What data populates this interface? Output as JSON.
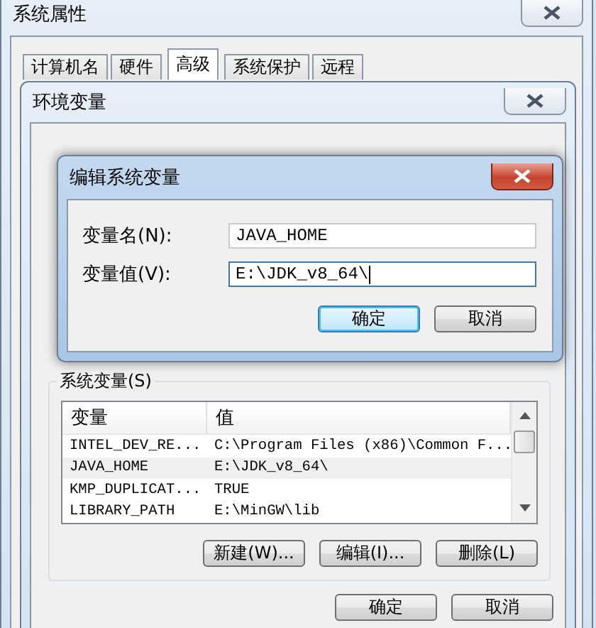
{
  "system_properties": {
    "title": "系统属性",
    "tabs": [
      {
        "label": "计算机名",
        "selected": false
      },
      {
        "label": "硬件",
        "selected": false
      },
      {
        "label": "高级",
        "selected": true
      },
      {
        "label": "系统保护",
        "selected": false
      },
      {
        "label": "远程",
        "selected": false
      }
    ]
  },
  "environment_variables": {
    "title": "环境变量",
    "system_variables": {
      "label": "系统变量(S)",
      "columns": [
        "变量",
        "值"
      ],
      "rows": [
        {
          "name": "INTEL_DEV_RE...",
          "value": "C:\\Program Files (x86)\\Common F...",
          "selected": false
        },
        {
          "name": "JAVA_HOME",
          "value": "E:\\JDK_v8_64\\",
          "selected": true
        },
        {
          "name": "KMP_DUPLICAT...",
          "value": "TRUE",
          "selected": false
        },
        {
          "name": "LIBRARY_PATH",
          "value": "E:\\MinGW\\lib",
          "selected": false
        }
      ]
    },
    "buttons": [
      "新建(W)...",
      "编辑(I)...",
      "删除(L)"
    ],
    "footer_buttons": [
      "确定",
      "取消"
    ]
  },
  "edit_dialog": {
    "title": "编辑系统变量",
    "fields": [
      {
        "label": "变量名(N):",
        "value": "JAVA_HOME",
        "focused": false
      },
      {
        "label": "变量值(V):",
        "value": "E:\\JDK_v8_64\\",
        "focused": true
      }
    ],
    "buttons": [
      {
        "label": "确定",
        "default": true
      },
      {
        "label": "取消",
        "default": false
      }
    ]
  }
}
